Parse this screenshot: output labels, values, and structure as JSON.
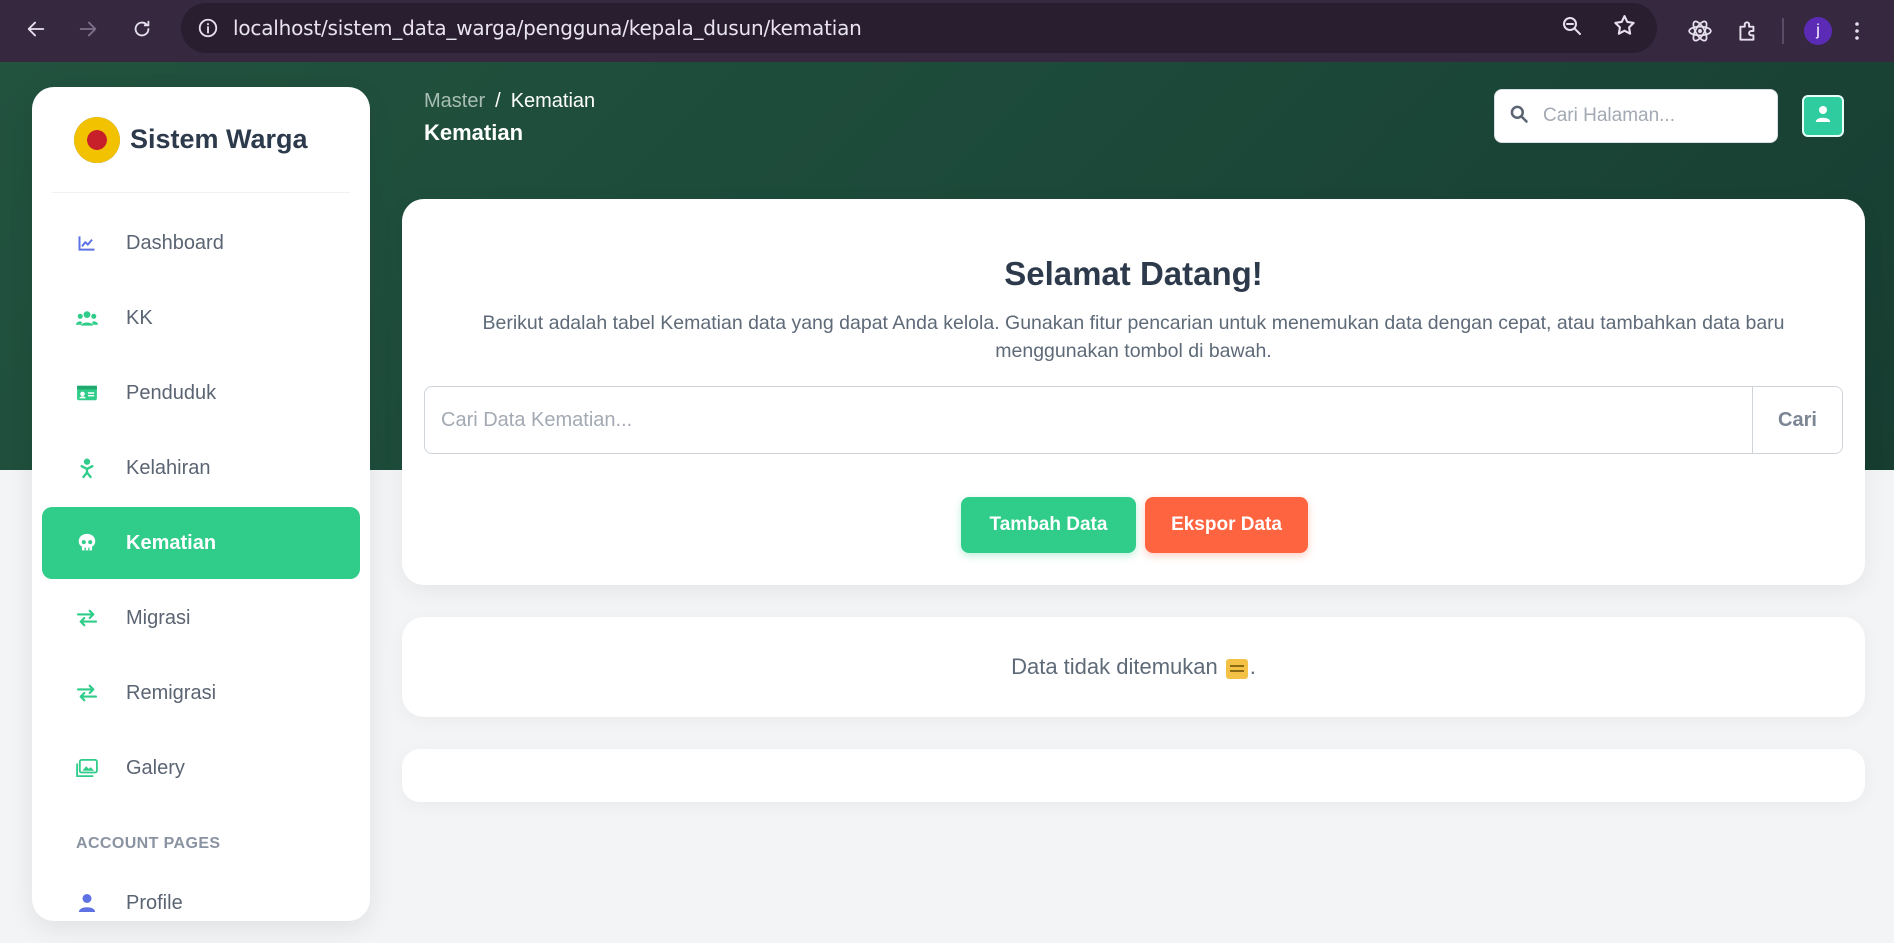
{
  "browser": {
    "url": "localhost/sistem_data_warga/pengguna/kepala_dusun/kematian",
    "profile_initial": "j"
  },
  "sidebar": {
    "brand": "Sistem Warga",
    "items": [
      {
        "label": "Dashboard",
        "icon": "chart-line-icon",
        "active": false
      },
      {
        "label": "KK",
        "icon": "users-icon",
        "active": false
      },
      {
        "label": "Penduduk",
        "icon": "id-card-icon",
        "active": false
      },
      {
        "label": "Kelahiran",
        "icon": "baby-icon",
        "active": false
      },
      {
        "label": "Kematian",
        "icon": "skull-icon",
        "active": true
      },
      {
        "label": "Migrasi",
        "icon": "exchange-icon",
        "active": false
      },
      {
        "label": "Remigrasi",
        "icon": "exchange-icon",
        "active": false
      },
      {
        "label": "Galery",
        "icon": "images-icon",
        "active": false
      }
    ],
    "section_label": "ACCOUNT PAGES",
    "profile_label": "Profile"
  },
  "header": {
    "breadcrumb_parent": "Master",
    "breadcrumb_sep": "/",
    "breadcrumb_current": "Kematian",
    "title": "Kematian",
    "search_placeholder": "Cari Halaman..."
  },
  "main": {
    "welcome_title": "Selamat Datang!",
    "welcome_desc": "Berikut adalah tabel Kematian data yang dapat Anda kelola. Gunakan fitur pencarian untuk menemukan data dengan cepat, atau tambahkan data baru menggunakan tombol di bawah.",
    "search_placeholder": "Cari Data Kematian...",
    "search_button": "Cari",
    "add_button": "Tambah Data",
    "export_button": "Ekspor Data",
    "empty_text": "Data tidak ditemukan",
    "empty_suffix": "."
  },
  "colors": {
    "accent": "#2fcc8a",
    "danger": "#ff6440",
    "hero": "#1b4738"
  }
}
